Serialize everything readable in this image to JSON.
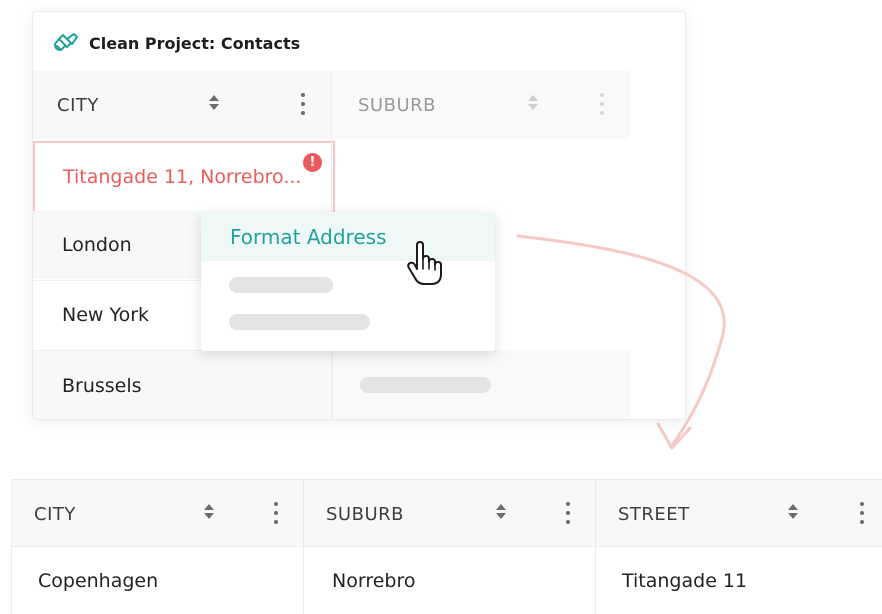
{
  "source_card": {
    "title": "Clean Project: Contacts",
    "title_icon": "paintbrush-icon",
    "columns": [
      {
        "label": "CITY"
      },
      {
        "label": "SUBURB"
      }
    ],
    "error_cell": {
      "value": "Titangade 11, Norrebro...",
      "badge": "!"
    },
    "rows": [
      {
        "city": "London"
      },
      {
        "city": "New York"
      },
      {
        "city": "Brussels"
      }
    ]
  },
  "context_menu": {
    "items": [
      {
        "label": "Format Address"
      }
    ]
  },
  "result_grid": {
    "columns": [
      {
        "label": "CITY"
      },
      {
        "label": "SUBURB"
      },
      {
        "label": "STREET"
      }
    ],
    "row": {
      "city": "Copenhagen",
      "suburb": "Norrebro",
      "street": "Titangade 11"
    }
  },
  "colors": {
    "accent_teal": "#23a29a",
    "error_red": "#ec5b5b",
    "arrow_pink": "#f6c9c6"
  }
}
